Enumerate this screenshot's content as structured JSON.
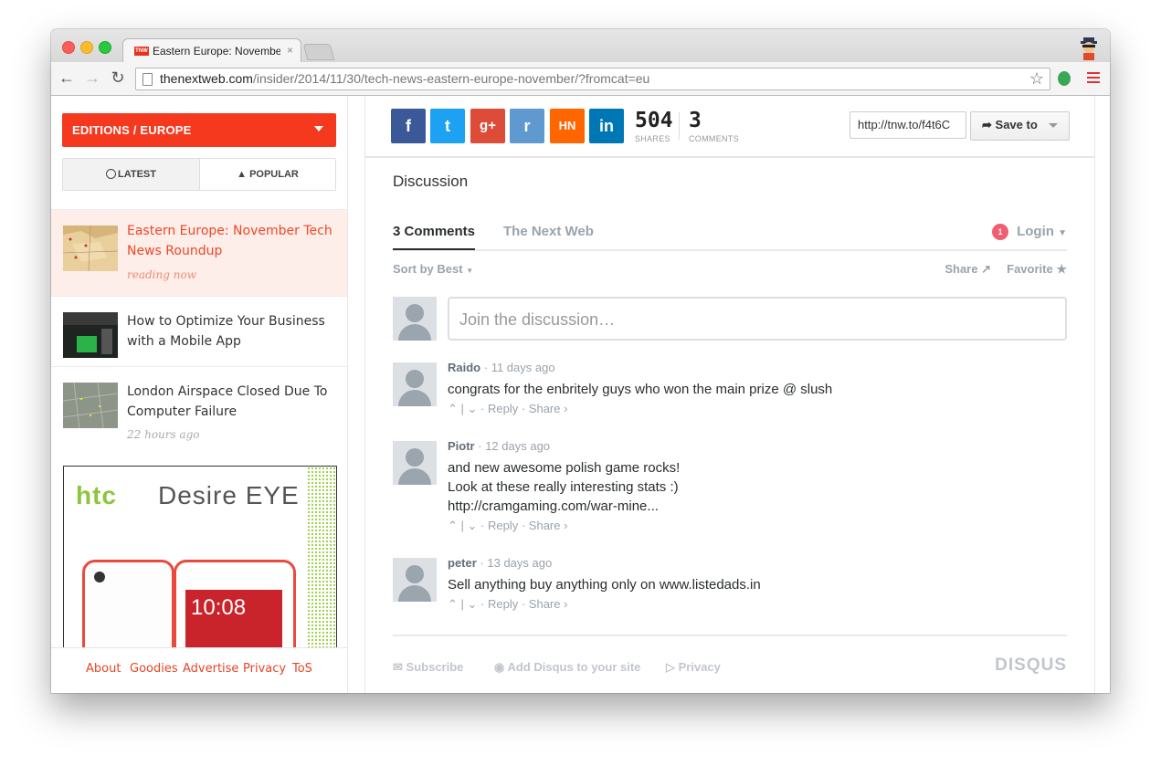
{
  "browser": {
    "tab_title": "Eastern Europe: Novembe",
    "tab_close": "×",
    "favicon_text": "TNW",
    "url_domain": "thenextweb.com",
    "url_path": "/insider/2014/11/30/tech-news-eastern-europe-november/?fromcat=eu",
    "back_glyph": "←",
    "forward_glyph": "→",
    "reload_glyph": "↻",
    "star_glyph": "☆"
  },
  "sidebar": {
    "editions_label": "EDITIONS / EUROPE",
    "latest_label": "LATEST",
    "popular_label": "POPULAR",
    "articles": [
      {
        "title": "Eastern Europe: November Tech News Roundup",
        "meta": "reading now"
      },
      {
        "title": "How to Optimize Your Business with a Mobile App",
        "meta": ""
      },
      {
        "title": "London Airspace Closed Due To Computer Failure",
        "meta": "22 hours ago"
      }
    ],
    "ad": {
      "brand": "htc",
      "model": "Desire EYE",
      "time": "10:08"
    },
    "footer_links": [
      "About",
      "Goodies",
      "Advertise",
      "Privacy",
      "ToS"
    ]
  },
  "share": {
    "buttons": [
      {
        "label": "f",
        "color": "#3b5998"
      },
      {
        "label": "t",
        "color": "#1da1f2"
      },
      {
        "label": "g+",
        "color": "#dd4b39"
      },
      {
        "label": "r",
        "color": "#5f99cf"
      },
      {
        "label": "HN",
        "color": "#ff6600"
      },
      {
        "label": "in",
        "color": "#0077b5"
      }
    ],
    "shares_count": "504",
    "shares_label": "SHARES",
    "comments_count": "3",
    "comments_label": "COMMENTS",
    "short_url": "http://tnw.to/f4t6C",
    "save_label": "Save to"
  },
  "disqus": {
    "heading": "Discussion",
    "tab_comments": "3 Comments",
    "tab_site": "The Next Web",
    "notification_count": "1",
    "login_label": "Login",
    "sort_label": "Sort by Best",
    "share_label": "Share",
    "favorite_label": "Favorite",
    "join_placeholder": "Join the discussion…",
    "comments": [
      {
        "author": "Raido",
        "time": "11 days ago",
        "lines": [
          "congrats for the enbritely guys who won the main prize @ slush"
        ]
      },
      {
        "author": "Piotr",
        "time": "12 days ago",
        "lines": [
          "and new awesome polish game rocks!",
          "Look at these really interesting stats :)",
          "http://cramgaming.com/war-mine..."
        ]
      },
      {
        "author": "peter",
        "time": "13 days ago",
        "lines": [
          "Sell anything buy anything only on www.listedads.in"
        ]
      }
    ],
    "reply_label": "Reply",
    "comment_share_label": "Share ›",
    "footer": {
      "subscribe": "Subscribe",
      "add_disqus": "Add Disqus to your site",
      "privacy": "Privacy",
      "logo": "DISQUS"
    }
  }
}
